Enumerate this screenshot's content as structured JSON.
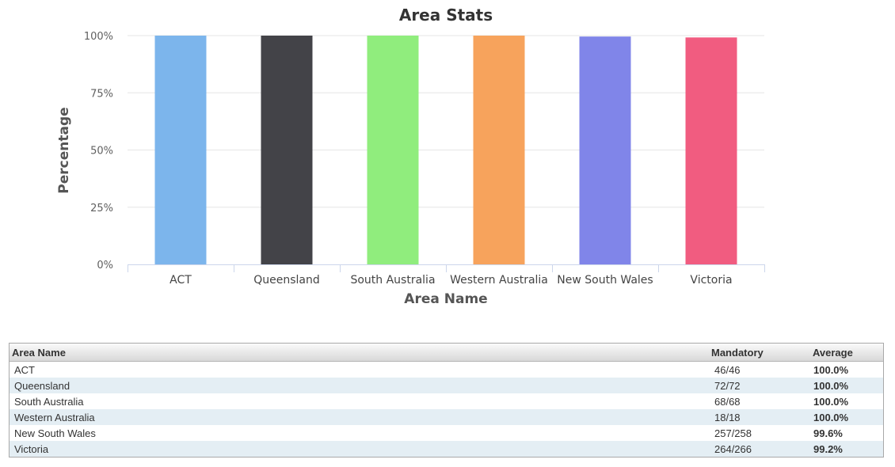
{
  "chart_data": {
    "type": "bar",
    "title": "Area Stats",
    "xlabel": "Area Name",
    "ylabel": "Percentage",
    "categories": [
      "ACT",
      "Queensland",
      "South Australia",
      "Western Australia",
      "New South Wales",
      "Victoria"
    ],
    "values": [
      100.0,
      100.0,
      100.0,
      100.0,
      99.6,
      99.2
    ],
    "colors": [
      "#7cb5ec",
      "#434348",
      "#90ed7d",
      "#f7a35c",
      "#8085e9",
      "#f15c80"
    ],
    "ylim": [
      0,
      100
    ],
    "yticks": [
      "0%",
      "25%",
      "50%",
      "75%",
      "100%"
    ],
    "grid": true,
    "legend": "none"
  },
  "table": {
    "headers": {
      "name": "Area Name",
      "mandatory": "Mandatory",
      "average": "Average"
    },
    "rows": [
      {
        "name": "ACT",
        "mandatory": "46/46",
        "average": "100.0%"
      },
      {
        "name": "Queensland",
        "mandatory": "72/72",
        "average": "100.0%"
      },
      {
        "name": "South Australia",
        "mandatory": "68/68",
        "average": "100.0%"
      },
      {
        "name": "Western Australia",
        "mandatory": "18/18",
        "average": "100.0%"
      },
      {
        "name": "New South Wales",
        "mandatory": "257/258",
        "average": "99.6%"
      },
      {
        "name": "Victoria",
        "mandatory": "264/266",
        "average": "99.2%"
      }
    ]
  }
}
